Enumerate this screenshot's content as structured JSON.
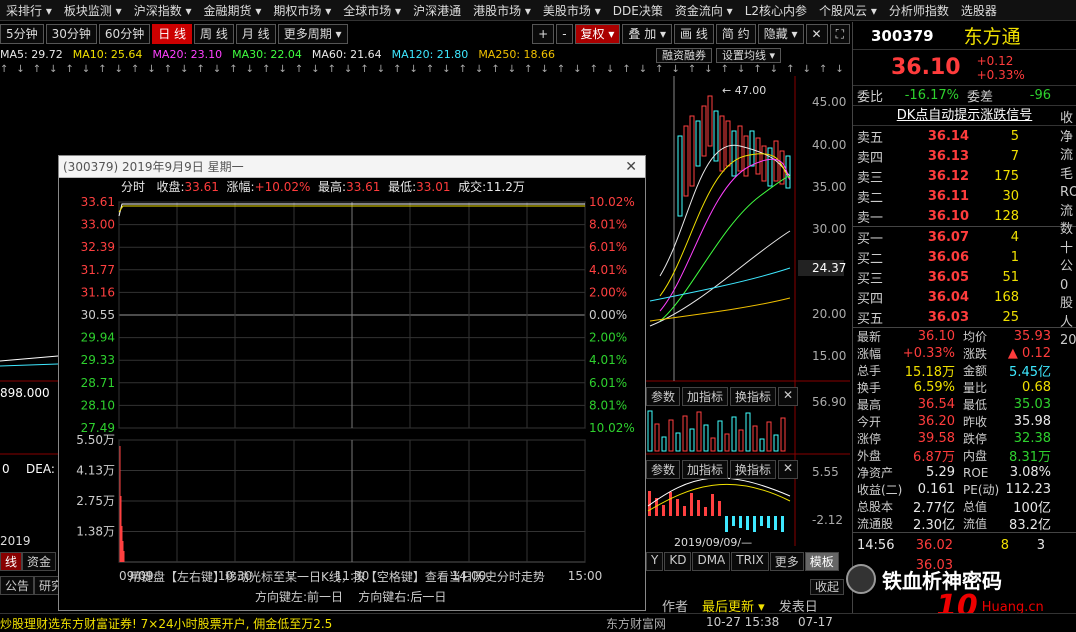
{
  "menu": [
    "采排行 ▾",
    "板块监测 ▾",
    "沪深指数 ▾",
    "金融期货 ▾",
    "期权市场 ▾",
    "全球市场 ▾",
    "沪深港通",
    "港股市场 ▾",
    "美股市场 ▾",
    "DDE决策",
    "资金流向 ▾",
    "L2核心内参",
    "个股风云 ▾",
    "分析师指数",
    "选股器"
  ],
  "toolbar": {
    "periods": [
      "5分钟",
      "30分钟",
      "60分钟",
      "日 线",
      "周 线",
      "月 线",
      "更多周期 ▾"
    ],
    "active_period": "日 线",
    "right_buttons": [
      "+",
      "-",
      "复权 ▾",
      "叠 加 ▾",
      "画 线",
      "简 约",
      "隐藏 ▾",
      "✕",
      "⛶"
    ]
  },
  "ma": [
    {
      "label": "MA5: 29.72",
      "color": "#e8e8e8"
    },
    {
      "label": "MA10: 25.64",
      "color": "#f0e000"
    },
    {
      "label": "MA20: 23.10",
      "color": "#ff40ff"
    },
    {
      "label": "MA30: 22.04",
      "color": "#40ff40"
    },
    {
      "label": "MA60: 21.64",
      "color": "#e8e8e8"
    },
    {
      "label": "MA120: 21.80",
      "color": "#3ee8ff"
    },
    {
      "label": "MA250: 18.66",
      "color": "#f0c000"
    }
  ],
  "chart_buttons": [
    "融资融券",
    "设置均线 ▾"
  ],
  "main_chart": {
    "price_axis": [
      "45.00",
      "40.00",
      "35.00",
      "30.00",
      "24.37",
      "20.00",
      "15.00"
    ],
    "high_label": "47.00",
    "vol_axis": [
      "56.90",
      "5.55",
      "-2.12"
    ],
    "indicator_tabs_1": [
      "参数",
      "加指标",
      "换指标",
      "✕"
    ],
    "indicator_tabs_2": [
      "参数",
      "加指标",
      "换指标",
      "✕"
    ],
    "left_labels": [
      "898.000",
      "0",
      "DEA:",
      "2019"
    ],
    "date_label": "2019/09/09/—",
    "bottom_tabs": [
      "Y",
      "KD",
      "DMA",
      "TRIX",
      "更多",
      "模板"
    ],
    "left_tabs": [
      "线",
      "资金",
      "公告",
      "研究"
    ]
  },
  "popup": {
    "title": "(300379) 2019年9月9日 星期一",
    "info": {
      "label1": "分时",
      "close_label": "收盘:",
      "close": "33.61",
      "chg_label": "涨幅:",
      "chg": "+10.02%",
      "high_label": "最高:",
      "high": "33.61",
      "low_label": "最低:",
      "low": "33.01",
      "vol_label": "成交:",
      "vol": "11.2万"
    },
    "price_left": [
      "33.61",
      "33.00",
      "32.39",
      "31.77",
      "31.16",
      "30.55",
      "29.94",
      "29.33",
      "28.71",
      "28.10",
      "27.49"
    ],
    "pct_right": [
      "10.02%",
      "8.01%",
      "6.01%",
      "4.01%",
      "2.00%",
      "0.00%",
      "2.00%",
      "4.01%",
      "6.01%",
      "8.01%",
      "10.02%"
    ],
    "vol_left": [
      "5.50万",
      "4.13万",
      "2.75万",
      "1.38万"
    ],
    "time_axis": [
      "09/09",
      "10:30",
      "11:30",
      "14:00",
      "15:00"
    ],
    "help1": "用键盘【左右键】移动光标至某一日K线，按【空格键】查看当日历史分时走势",
    "help2": "方向键左:前一日    方向键右:后一日"
  },
  "quote": {
    "code": "300379",
    "name": "东方通",
    "price": "36.10",
    "change": "+0.12",
    "change_pct": "+0.33%",
    "weibi_label": "委比",
    "weibi": "-16.17%",
    "weicha_label": "委差",
    "weicha": "-96",
    "signal": "DK点自动提示涨跌信号",
    "asks": [
      {
        "label": "卖五",
        "price": "36.14",
        "vol": "5"
      },
      {
        "label": "卖四",
        "price": "36.13",
        "vol": "7"
      },
      {
        "label": "卖三",
        "price": "36.12",
        "vol": "175"
      },
      {
        "label": "卖二",
        "price": "36.11",
        "vol": "30"
      },
      {
        "label": "卖一",
        "price": "36.10",
        "vol": "128"
      }
    ],
    "bids": [
      {
        "label": "买一",
        "price": "36.07",
        "vol": "4"
      },
      {
        "label": "买二",
        "price": "36.06",
        "vol": "1"
      },
      {
        "label": "买三",
        "price": "36.05",
        "vol": "51"
      },
      {
        "label": "买四",
        "price": "36.04",
        "vol": "168"
      },
      {
        "label": "买五",
        "price": "36.03",
        "vol": "25"
      }
    ],
    "stats": [
      {
        "l1": "最新",
        "v1": "36.10",
        "c1": "up",
        "l2": "均价",
        "v2": "35.93",
        "c2": "up"
      },
      {
        "l1": "涨幅",
        "v1": "+0.33%",
        "c1": "up",
        "l2": "涨跌",
        "v2": "▲ 0.12",
        "c2": "up"
      },
      {
        "l1": "总手",
        "v1": "15.18万",
        "c1": "yel",
        "l2": "金额",
        "v2": "5.45亿",
        "c2": "cyan"
      },
      {
        "l1": "换手",
        "v1": "6.59%",
        "c1": "yel",
        "l2": "量比",
        "v2": "0.68",
        "c2": "yel"
      },
      {
        "l1": "最高",
        "v1": "36.54",
        "c1": "up",
        "l2": "最低",
        "v2": "35.03",
        "c2": "down"
      },
      {
        "l1": "今开",
        "v1": "36.20",
        "c1": "up",
        "l2": "昨收",
        "v2": "35.98",
        "c2": "wht"
      },
      {
        "l1": "涨停",
        "v1": "39.58",
        "c1": "up",
        "l2": "跌停",
        "v2": "32.38",
        "c2": "down"
      },
      {
        "l1": "外盘",
        "v1": "6.87万",
        "c1": "up",
        "l2": "内盘",
        "v2": "8.31万",
        "c2": "down"
      },
      {
        "l1": "净资产",
        "v1": "5.29",
        "c1": "wht",
        "l2": "ROE",
        "v2": "3.08%",
        "c2": "wht"
      },
      {
        "l1": "收益(二)",
        "v1": "0.161",
        "c1": "wht",
        "l2": "PE(动)",
        "v2": "112.23",
        "c2": "wht"
      },
      {
        "l1": "总股本",
        "v1": "2.77亿",
        "c1": "wht",
        "l2": "总值",
        "v2": "100亿",
        "c2": "wht"
      },
      {
        "l1": "流通股",
        "v1": "2.30亿",
        "c1": "wht",
        "l2": "流值",
        "v2": "83.2亿",
        "c2": "wht"
      }
    ],
    "tick": {
      "time": "14:56",
      "price": "36.02",
      "vol": "8",
      "n": "3"
    },
    "last_price": "36.03",
    "edge_chars": [
      "收",
      "净",
      "流",
      "毛",
      "ROI",
      "流",
      "数",
      "十",
      "公",
      "0",
      "股",
      "人",
      "20"
    ]
  },
  "bottom": {
    "ad": "炒股理财选东方财富证券! 7×24小时股票开户, 佣金低至万2.5",
    "brand": "东方财富网",
    "author": "作者",
    "latest": "最后更新 ▾",
    "publish": "发表日",
    "time1": "10-27 15:38",
    "time2": "07-17",
    "collapse": "收起",
    "watermark": "铁血析神密码",
    "watermark_brand": "Huang.cn"
  }
}
